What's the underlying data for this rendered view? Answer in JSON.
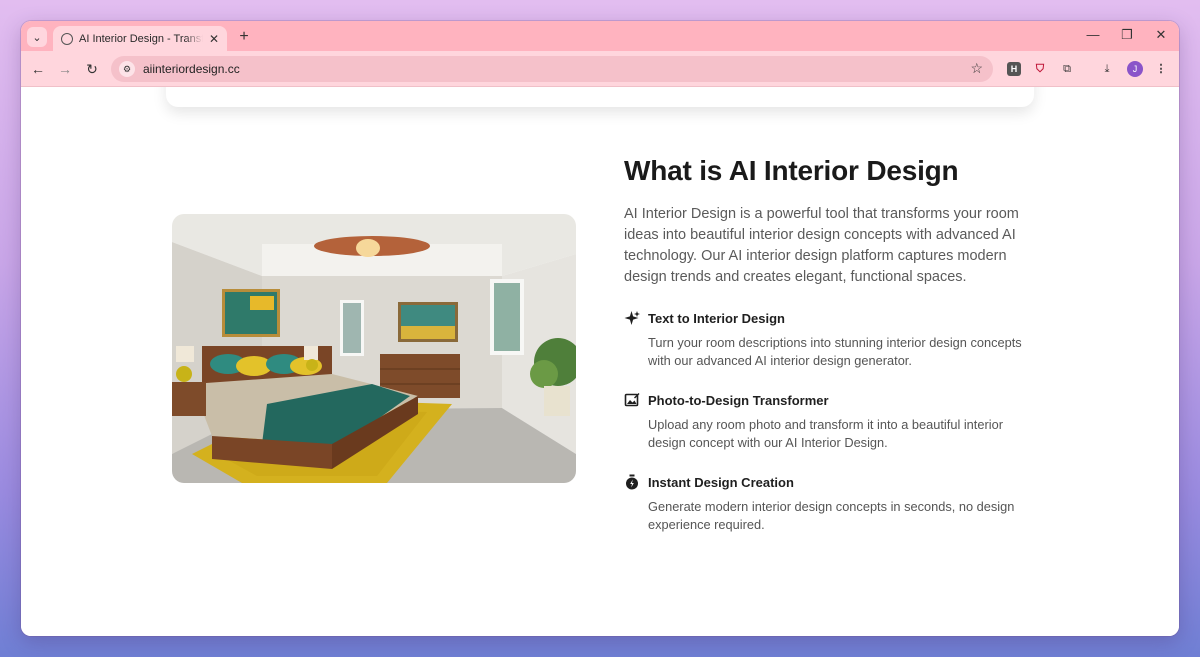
{
  "browser": {
    "tab_title": "AI Interior Design - Transform Y",
    "new_tab": "+",
    "close_tab": "✕",
    "url": "aiinteriordesign.cc",
    "avatar_initial": "J",
    "extensions": [
      "H"
    ],
    "window_controls": [
      "—",
      "❐",
      "✕"
    ]
  },
  "page": {
    "heading": "What is AI Interior Design",
    "intro": "AI Interior Design is a powerful tool that transforms your room ideas into beautiful interior design concepts with advanced AI technology. Our AI interior design platform captures modern design trends and creates elegant, functional spaces.",
    "features": [
      {
        "icon": "sparkle-icon",
        "title": "Text to Interior Design",
        "description": "Turn your room descriptions into stunning interior design concepts with our advanced AI interior design generator."
      },
      {
        "icon": "image-edit-icon",
        "title": "Photo-to-Design Transformer",
        "description": "Upload any room photo and transform it into a beautiful interior design concept with our AI Interior Design."
      },
      {
        "icon": "timer-icon",
        "title": "Instant Design Creation",
        "description": "Generate modern interior design concepts in seconds, no design experience required."
      }
    ]
  },
  "colors": {
    "titlebar": "#ffb3bf",
    "toolbar": "#ffd6dd",
    "heading": "#1a1a1a",
    "body_text": "#5a5a5a"
  }
}
